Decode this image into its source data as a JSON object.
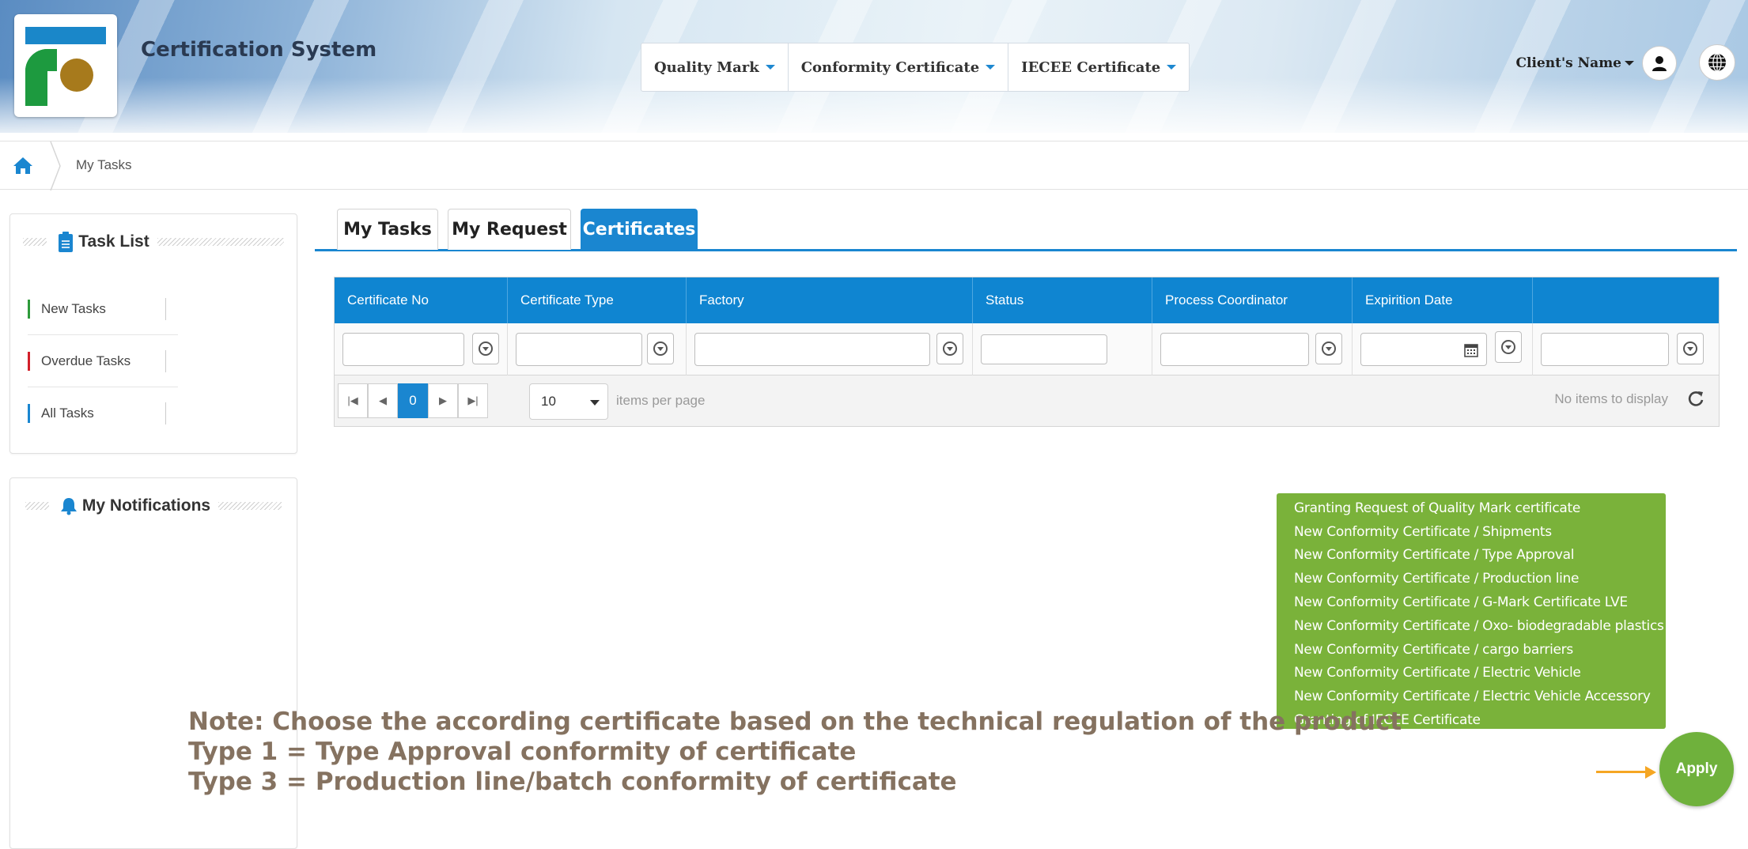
{
  "app": {
    "title": "Certification System"
  },
  "nav": {
    "items": [
      {
        "label": "Quality Mark"
      },
      {
        "label": "Conformity Certificate"
      },
      {
        "label": "IECEE Certificate"
      }
    ]
  },
  "user": {
    "name": "Client's Name"
  },
  "breadcrumb": {
    "current": "My Tasks"
  },
  "sidebar": {
    "task_list": {
      "title": "Task List",
      "items": [
        {
          "label": "New Tasks",
          "color": "#2e9a3a"
        },
        {
          "label": "Overdue Tasks",
          "color": "#d2202a"
        },
        {
          "label": "All Tasks",
          "color": "#1a86d0"
        }
      ]
    },
    "notifications": {
      "title": "My Notifications"
    }
  },
  "tabs": [
    {
      "label": "My Tasks",
      "active": false
    },
    {
      "label": "My Request",
      "active": false
    },
    {
      "label": "Certificates",
      "active": true
    }
  ],
  "grid": {
    "columns": [
      "Certificate No",
      "Certificate Type",
      "Factory",
      "Status",
      "Process Coordinator",
      "Expirition Date",
      ""
    ],
    "pager": {
      "current_page": "0",
      "page_size": "10",
      "page_size_label": "items per page",
      "status": "No items to display"
    }
  },
  "cert_menu": {
    "items": [
      "Granting Request of Quality Mark certificate",
      "New Conformity Certificate / Shipments",
      "New Conformity Certificate / Type Approval",
      "New Conformity Certificate / Production line",
      "New Conformity Certificate / G-Mark Certificate LVE",
      "New Conformity Certificate / Oxo- biodegradable plastics",
      "New Conformity Certificate / cargo barriers",
      "New Conformity Certificate / Electric Vehicle",
      "New Conformity Certificate / Electric Vehicle Accessory",
      "Granting of IECEE Certificate"
    ]
  },
  "note": {
    "line1": "Note: Choose the according certificate based on the technical regulation of the product",
    "line2": "Type 1 = Type Approval conformity of certificate",
    "line3": "Type 3 = Production line/batch conformity of certificate"
  },
  "apply": {
    "label": "Apply"
  },
  "colors": {
    "primary": "#1a86d0",
    "menu_green": "#7ab23a",
    "apply_green": "#6fb13c",
    "arrow": "#f5a623",
    "note_text": "#857260"
  }
}
